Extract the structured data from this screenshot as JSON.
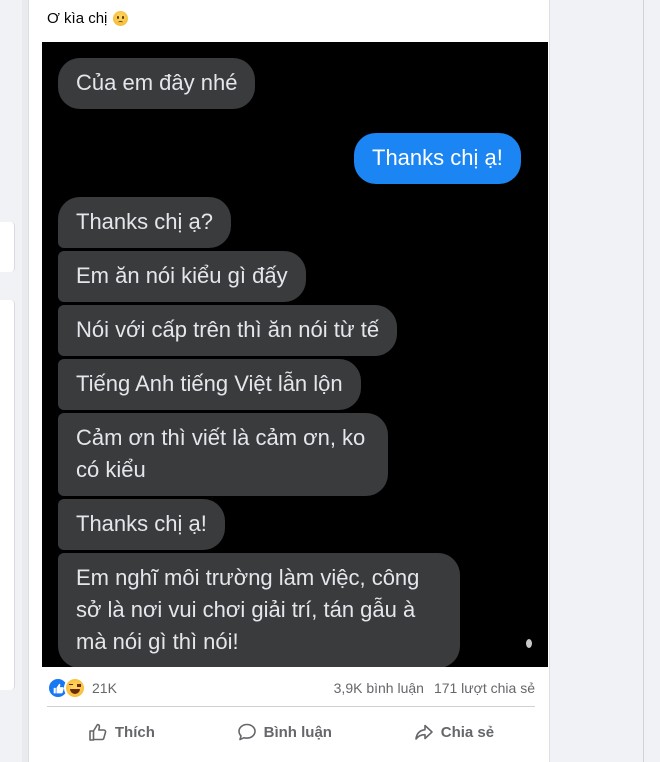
{
  "post": {
    "caption_text": "Ơ kìa chị",
    "caption_emoji": "tired-face-emoji"
  },
  "chat": {
    "messages": [
      {
        "side": "in",
        "text": "Của em đây nhé"
      },
      {
        "side": "out",
        "text": "Thanks chị ạ!"
      },
      {
        "side": "in",
        "text": "Thanks chị ạ?"
      },
      {
        "side": "in",
        "text": "Em ăn nói kiểu gì đấy"
      },
      {
        "side": "in",
        "text": "Nói với cấp trên thì ăn nói từ tế"
      },
      {
        "side": "in",
        "text": "Tiếng Anh tiếng Việt lẫn lộn"
      },
      {
        "side": "in",
        "text": "Cảm ơn thì viết là cảm ơn, ko có kiểu"
      },
      {
        "side": "in",
        "text": "Thanks chị ạ!"
      },
      {
        "side": "in",
        "text": "Em nghĩ môi trường làm việc, công sở là nơi vui chơi giải trí, tán gẫu à mà nói gì thì nói!"
      }
    ],
    "colors": {
      "background": "#000000",
      "incoming_bubble": "#3a3b3c",
      "outgoing_bubble": "#1a85f3"
    }
  },
  "stats": {
    "reaction_icons": [
      "like-icon",
      "haha-icon"
    ],
    "reaction_count": "21K",
    "comments": "3,9K bình luận",
    "shares": "171 lượt chia sẻ"
  },
  "actions": {
    "like_label": "Thích",
    "comment_label": "Bình luận",
    "share_label": "Chia sẻ"
  }
}
